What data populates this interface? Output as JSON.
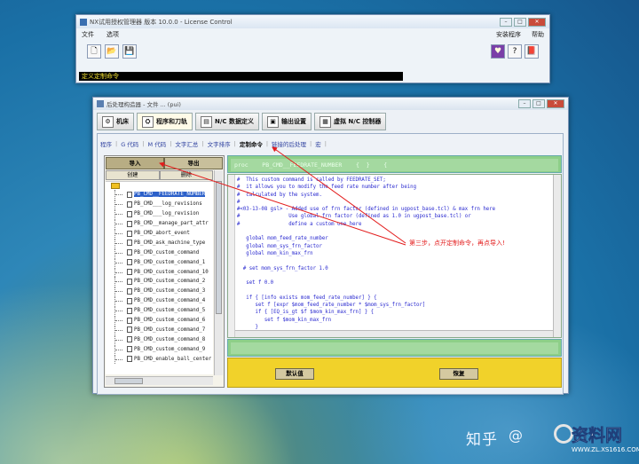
{
  "window_top": {
    "title": "NX试用授权管理器 版本 10.0.0 - License Control",
    "menu": [
      "文件",
      "选项"
    ],
    "menu_right": [
      "安装程序",
      "帮助"
    ],
    "status": "定义定制命令"
  },
  "window_main": {
    "title": "后处理构造器 - 文件 ... (pui)",
    "tabs": [
      {
        "label": "机床",
        "icon": "machine-icon"
      },
      {
        "label": "程序和刀轨",
        "icon": "toolpath-icon"
      },
      {
        "label": "N/C 数据定义",
        "icon": "nc-data-icon"
      },
      {
        "label": "输出设置",
        "icon": "output-icon"
      },
      {
        "label": "虚拟 N/C 控制器",
        "icon": "virtual-nc-icon"
      }
    ],
    "subtabs": [
      "程序",
      "G 代码",
      "M 代码",
      "文字汇总",
      "文字排序",
      "定制命令",
      "链接的后处理",
      "宏"
    ],
    "active_subtab": "定制命令",
    "left_panel": {
      "import_label": "导入",
      "export_label": "导出",
      "create_label": "创建",
      "delete_label": "删除",
      "tree_items": [
        "PB_CMD__FEEDRATE_NUMBER",
        "PB_CMD___log_revisions",
        "PB_CMD___log_revision",
        "PB_CMD__manage_part_attr",
        "PB_CMD_abort_event",
        "PB_CMD_ask_machine_type",
        "PB_CMD_custom_command",
        "PB_CMD_custom_command_1",
        "PB_CMD_custom_command_10",
        "PB_CMD_custom_command_2",
        "PB_CMD_custom_command_3",
        "PB_CMD_custom_command_4",
        "PB_CMD_custom_command_5",
        "PB_CMD_custom_command_6",
        "PB_CMD_custom_command_7",
        "PB_CMD_custom_command_8",
        "PB_CMD_custom_command_9",
        "PB_CMD_enable_ball_center"
      ],
      "selected_item": "PB_CMD__FEEDRATE_NUMBER"
    },
    "editor": {
      "header": "proc    PB_CMD__FEEDRATE_NUMBER    {  }    {",
      "code": "#  This custom command is called by FEEDRATE_SET;\n#  it allows you to modify the feed rate number after being\n#  calculated by the system.\n#\n#<03-13-08 gsl> - Added use of frn factor (defined in ugpost_base.tcl) & max frn here\n#                Use global frn factor (defined as 1.0 in ugpost_base.tcl) or\n#                define a custom one here\n\n   global mom_feed_rate_number\n   global mom_sys_frn_factor\n   global mom_kin_max_frn\n\n  # set mom_sys_frn_factor 1.0\n\n   set f 0.0\n\n   if { [info exists mom_feed_rate_number] } {\n      set f [expr $mom_feed_rate_number * $mom_sys_frn_factor]\n      if { [EQ_is_gt $f $mom_kin_max_frn] } {\n         set f $mom_kin_max_frn\n      }\n   }",
      "default_button": "默认值",
      "restore_button": "恢复"
    },
    "annotation": "第三步，点开定制命令，再点导入!"
  },
  "watermark": {
    "zhihu": "知乎",
    "at": "@",
    "logo_text": "资料网",
    "logo_url": "WWW.ZL.XS1616.COM"
  }
}
